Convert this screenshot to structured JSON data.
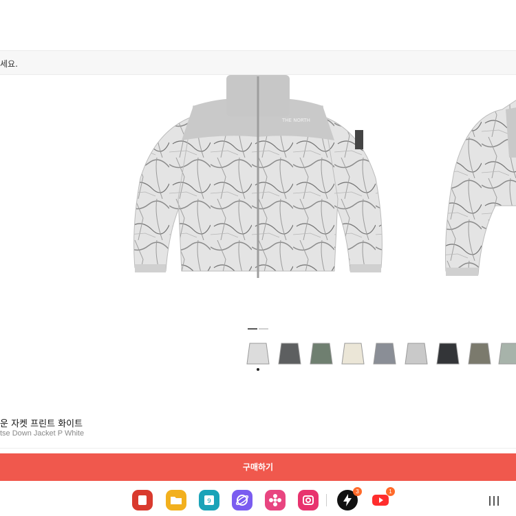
{
  "notice": {
    "text": "세요."
  },
  "gallery": {
    "images": [
      "jacket-front-marble-white",
      "jacket-side-marble-white"
    ],
    "thumbnails": [
      {
        "name": "thumb-marble-white",
        "color": "#dcdcdc"
      },
      {
        "name": "thumb-charcoal",
        "color": "#5d5f60"
      },
      {
        "name": "thumb-green",
        "color": "#6f7f70"
      },
      {
        "name": "thumb-cream",
        "color": "#ebe6d7"
      },
      {
        "name": "thumb-grey-print",
        "color": "#8a8e96"
      },
      {
        "name": "thumb-white-print",
        "color": "#c9c9c9"
      },
      {
        "name": "thumb-black",
        "color": "#333538"
      },
      {
        "name": "thumb-khaki",
        "color": "#7b7a6d"
      },
      {
        "name": "thumb-sage",
        "color": "#a7b3aa"
      }
    ]
  },
  "product": {
    "name_ko": "운 자켓 프린트 화이트",
    "name_en": "tse Down Jacket P White"
  },
  "buy_button": {
    "label": "구매하기",
    "color": "#f0584d"
  },
  "taskbar": {
    "apps": [
      {
        "name": "red-app-icon",
        "color": "#d93a2e"
      },
      {
        "name": "yellow-folder-app-icon",
        "color": "#f2b01e"
      },
      {
        "name": "calendar-app-icon",
        "color": "#1aa3b8",
        "text": "9"
      },
      {
        "name": "internet-app-icon",
        "color": "#7a5cf0"
      },
      {
        "name": "gallery-app-icon",
        "color": "#e84580"
      },
      {
        "name": "camera-app-icon",
        "color": "#e8336e"
      },
      {
        "name": "bolt-app-icon",
        "color": "#111111",
        "badge": "3"
      },
      {
        "name": "youtube-app-icon",
        "color": "#ff2d2d",
        "badge": "1"
      }
    ]
  }
}
